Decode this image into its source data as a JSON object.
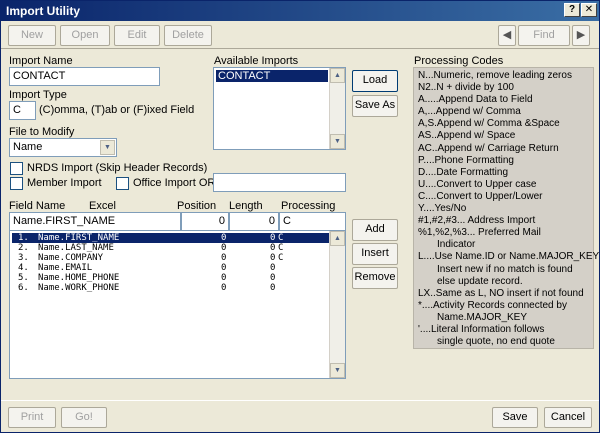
{
  "window": {
    "title": "Import Utility",
    "help_label": "?",
    "close_label": "✕"
  },
  "toolbar": {
    "new_label": "New",
    "open_label": "Open",
    "edit_label": "Edit",
    "delete_label": "Delete",
    "find_label": "Find",
    "prev_label": "◀",
    "next_label": "▶"
  },
  "import_name": {
    "label": "Import Name",
    "value": "CONTACT"
  },
  "import_type": {
    "label": "Import Type",
    "value": "C",
    "hint": "(C)omma, (T)ab or (F)ixed Field"
  },
  "file_to_modify": {
    "label": "File to Modify",
    "value": "Name"
  },
  "available_imports": {
    "label": "Available Imports",
    "items": [
      "CONTACT"
    ],
    "selected_index": 0
  },
  "side_buttons": {
    "load_label": "Load",
    "save_as_label": "Save As"
  },
  "options": {
    "nrds_label": "NRDS Import (Skip Header Records)",
    "member_label": "Member Import",
    "office_label": "Office Import OR:",
    "office_value": ""
  },
  "fields": {
    "headers": {
      "field_name": "Field Name",
      "excel": "Excel",
      "position": "Position",
      "length": "Length",
      "processing": "Processing"
    },
    "edit_row": {
      "name": "Name.FIRST_NAME",
      "position": "0",
      "length": "0",
      "processing": "C"
    },
    "rows": [
      {
        "num": "1.",
        "name": "Name.FIRST_NAME",
        "position": "0",
        "length": "0",
        "processing": "C"
      },
      {
        "num": "2.",
        "name": "Name.LAST_NAME",
        "position": "0",
        "length": "0",
        "processing": "C"
      },
      {
        "num": "3.",
        "name": "Name.COMPANY",
        "position": "0",
        "length": "0",
        "processing": "C"
      },
      {
        "num": "4.",
        "name": "Name.EMAIL",
        "position": "0",
        "length": "0",
        "processing": ""
      },
      {
        "num": "5.",
        "name": "Name.HOME_PHONE",
        "position": "0",
        "length": "0",
        "processing": ""
      },
      {
        "num": "6.",
        "name": "Name.WORK_PHONE",
        "position": "0",
        "length": "0",
        "processing": ""
      }
    ],
    "selected_index": 0
  },
  "row_buttons": {
    "add_label": "Add",
    "insert_label": "Insert",
    "remove_label": "Remove"
  },
  "processing_codes": {
    "title": "Processing Codes",
    "lines": [
      {
        "text": "N...Numeric, remove leading zeros",
        "indent": false
      },
      {
        "text": "N2..N + divide by 100",
        "indent": false
      },
      {
        "text": "A.....Append Data to Field",
        "indent": false
      },
      {
        "text": "A,...Append w/ Comma",
        "indent": false
      },
      {
        "text": "A,S.Append w/ Comma &Space",
        "indent": false
      },
      {
        "text": "AS..Append w/ Space",
        "indent": false
      },
      {
        "text": "AC..Append w/ Carriage Return",
        "indent": false
      },
      {
        "text": "P....Phone Formatting",
        "indent": false
      },
      {
        "text": "D....Date Formatting",
        "indent": false
      },
      {
        "text": "U....Convert to Upper case",
        "indent": false
      },
      {
        "text": "C....Convert to Upper/Lower",
        "indent": false
      },
      {
        "text": "Y....Yes/No",
        "indent": false
      },
      {
        "text": "#1,#2,#3... Address Import",
        "indent": false
      },
      {
        "text": "%1,%2,%3... Preferred Mail",
        "indent": false
      },
      {
        "text": "Indicator",
        "indent": true
      },
      {
        "text": "L....Use Name.ID or Name.MAJOR_KEY",
        "indent": false
      },
      {
        "text": "Insert new if no match is found",
        "indent": true
      },
      {
        "text": "else update record.",
        "indent": true
      },
      {
        "text": "LX..Same as L, NO insert if not found",
        "indent": false
      },
      {
        "text": "*....Activity Records connected by",
        "indent": false
      },
      {
        "text": "Name.MAJOR_KEY",
        "indent": true
      },
      {
        "text": "'....Literal Information follows",
        "indent": false
      },
      {
        "text": "single quote, no end quote",
        "indent": true
      }
    ]
  },
  "footer": {
    "print_label": "Print",
    "go_label": "Go!",
    "save_label": "Save",
    "cancel_label": "Cancel"
  }
}
